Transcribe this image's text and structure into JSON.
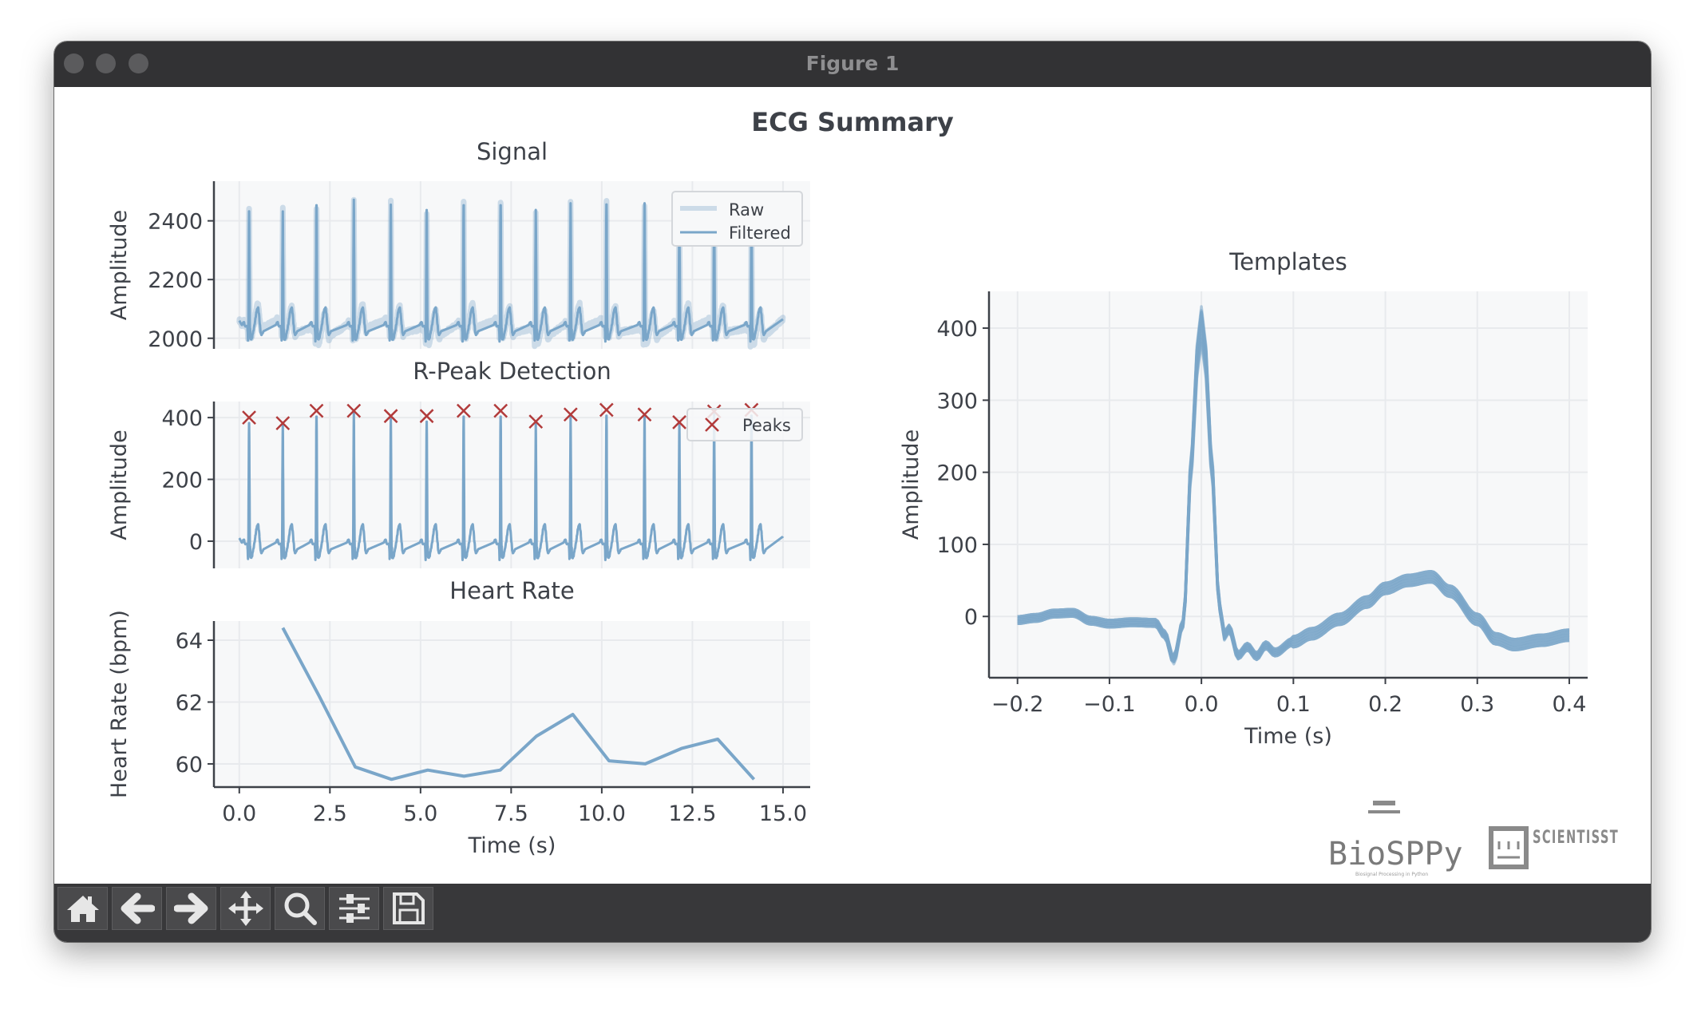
{
  "window": {
    "title": "Figure 1"
  },
  "figure": {
    "suptitle": "ECG Summary"
  },
  "toolbar": {
    "buttons": [
      {
        "name": "home",
        "icon": "home-icon"
      },
      {
        "name": "back",
        "icon": "arrow-left-icon"
      },
      {
        "name": "forward",
        "icon": "arrow-right-icon"
      },
      {
        "name": "pan",
        "icon": "move-icon"
      },
      {
        "name": "zoom",
        "icon": "magnifier-icon"
      },
      {
        "name": "configure-subplots",
        "icon": "sliders-icon"
      },
      {
        "name": "save",
        "icon": "floppy-disk-icon"
      }
    ]
  },
  "logos": {
    "biosppy": "BioSPPy",
    "biosppy_tagline": "Biosignal Processing in Python",
    "scientisst": "SCIENTISST"
  },
  "colors": {
    "line": "#7aa6c9",
    "peaks": "#b23b3b",
    "axes_bg": "#f7f8f9",
    "grid": "#e8eaed",
    "text": "#3d4148"
  },
  "chart_data": [
    {
      "id": "signal",
      "type": "line",
      "title": "Signal",
      "ylabel": "Amplitude",
      "xlim": [
        -0.7,
        15.75
      ],
      "ylim": [
        1964,
        2535
      ],
      "yticks": [
        "2000",
        "2200",
        "2400"
      ],
      "ytick_values": [
        2000,
        2200,
        2400
      ],
      "grid": true,
      "legend": {
        "placement": "top-right",
        "entries": [
          "Raw",
          "Filtered"
        ]
      },
      "series": [
        {
          "name": "Raw"
        },
        {
          "name": "Filtered"
        }
      ],
      "duration_s": 15.0
    },
    {
      "id": "rpeaks",
      "type": "line",
      "title": "R-Peak Detection",
      "ylabel": "Amplitude",
      "xlim": [
        -0.7,
        15.75
      ],
      "ylim": [
        -88,
        452
      ],
      "yticks": [
        "0",
        "200",
        "400"
      ],
      "ytick_values": [
        0,
        200,
        400
      ],
      "grid": true,
      "legend": {
        "placement": "top-right",
        "entries": [
          "Peaks"
        ]
      },
      "peaks": {
        "name": "Peaks",
        "t": [
          0.27,
          1.2,
          2.13,
          3.16,
          4.18,
          5.17,
          6.19,
          7.21,
          8.18,
          9.14,
          10.13,
          11.18,
          12.14,
          13.1,
          14.13
        ],
        "amplitude": [
          400,
          382,
          422,
          422,
          405,
          405,
          422,
          422,
          387,
          410,
          425,
          410,
          385,
          420,
          425
        ]
      }
    },
    {
      "id": "heart_rate",
      "type": "line",
      "title": "Heart Rate",
      "xlabel": "Time (s)",
      "ylabel": "Heart Rate (bpm)",
      "xlim": [
        -0.7,
        15.75
      ],
      "ylim": [
        59.25,
        64.62
      ],
      "xticks": [
        "0.0",
        "2.5",
        "5.0",
        "7.5",
        "10.0",
        "12.5",
        "15.0"
      ],
      "xtick_values": [
        0,
        2.5,
        5,
        7.5,
        10,
        12.5,
        15
      ],
      "yticks": [
        "60",
        "62",
        "64"
      ],
      "ytick_values": [
        60,
        62,
        64
      ],
      "grid": true,
      "x": [
        1.2,
        2.2,
        3.2,
        4.2,
        5.2,
        6.2,
        7.2,
        8.2,
        9.2,
        10.2,
        11.2,
        12.2,
        13.2,
        14.2
      ],
      "y": [
        64.4,
        62.2,
        59.9,
        59.5,
        59.8,
        59.6,
        59.8,
        60.9,
        61.6,
        60.1,
        60.0,
        60.5,
        60.8,
        59.5
      ]
    },
    {
      "id": "templates",
      "type": "line",
      "title": "Templates",
      "xlabel": "Time (s)",
      "ylabel": "Amplitude",
      "xlim": [
        -0.231,
        0.42
      ],
      "ylim": [
        -85,
        451
      ],
      "xticks": [
        "−0.2",
        "−0.1",
        "0.0",
        "0.1",
        "0.2",
        "0.3",
        "0.4"
      ],
      "xtick_values": [
        -0.2,
        -0.1,
        0,
        0.1,
        0.2,
        0.3,
        0.4
      ],
      "yticks": [
        "0",
        "100",
        "200",
        "300",
        "400"
      ],
      "ytick_values": [
        0,
        100,
        200,
        300,
        400
      ],
      "grid": true,
      "mean_template": {
        "t": [
          -0.2,
          -0.18,
          -0.16,
          -0.14,
          -0.12,
          -0.1,
          -0.075,
          -0.05,
          -0.04,
          -0.03,
          -0.02,
          -0.01,
          -0.005,
          0.0,
          0.005,
          0.01,
          0.02,
          0.025,
          0.03,
          0.04,
          0.05,
          0.06,
          0.07,
          0.08,
          0.1,
          0.12,
          0.15,
          0.18,
          0.2,
          0.225,
          0.25,
          0.27,
          0.3,
          0.32,
          0.34,
          0.37,
          0.4
        ],
        "y": [
          -5,
          -2,
          4,
          5,
          -6,
          -10,
          -8,
          -9,
          -25,
          -61,
          -10,
          235,
          370,
          425,
          370,
          235,
          13,
          -28,
          -17,
          -54,
          -42,
          -55,
          -40,
          -50,
          -35,
          -24,
          -4,
          20,
          39,
          50,
          55,
          35,
          -4,
          -31,
          -39,
          -33,
          -26
        ]
      },
      "count": 15
    }
  ]
}
